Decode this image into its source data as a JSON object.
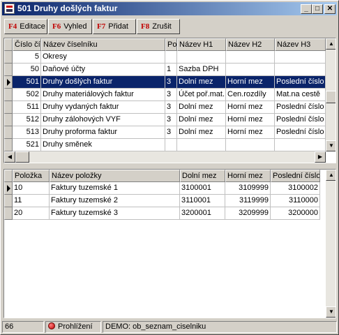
{
  "window": {
    "title": "501 Druhy došlých faktur"
  },
  "toolbar": [
    {
      "key": "F4",
      "label": "Editace"
    },
    {
      "key": "F6",
      "label": "Vyhled"
    },
    {
      "key": "F7",
      "label": "Přidat"
    },
    {
      "key": "F8",
      "label": "Zrušit"
    }
  ],
  "top_grid": {
    "columns": [
      "Číslo čí",
      "Název číselníku",
      "Po",
      "Název H1",
      "Název H2",
      "Název H3"
    ],
    "rows": [
      [
        "5",
        "Okresy",
        "",
        "",
        "",
        ""
      ],
      [
        "50",
        "Daňové účty",
        "1",
        "Sazba DPH",
        "",
        ""
      ],
      [
        "501",
        "Druhy došlých faktur",
        "3",
        "Dolní mez",
        "Horní mez",
        "Poslední číslo"
      ],
      [
        "502",
        "Druhy materiálových faktur",
        "3",
        "Účet poř.mat.",
        "Cen.rozdíly",
        "Mat.na cestě"
      ],
      [
        "511",
        "Druhy vydaných faktur",
        "3",
        "Dolní mez",
        "Horní mez",
        "Poslední číslo"
      ],
      [
        "512",
        "Druhy zálohových VYF",
        "3",
        "Dolní mez",
        "Horní mez",
        "Poslední číslo"
      ],
      [
        "513",
        "Druhy proforma faktur",
        "3",
        "Dolní mez",
        "Horní mez",
        "Poslední číslo"
      ],
      [
        "521",
        "Druhy směnek",
        "",
        "",
        "",
        ""
      ]
    ],
    "selected_row": 2
  },
  "bottom_grid": {
    "columns": [
      "Položka",
      "Název položky",
      "Dolní mez",
      "Horní mez",
      "Poslední číslo"
    ],
    "rows": [
      [
        "10",
        "Faktury tuzemské 1",
        "3100001",
        "3109999",
        "3100002"
      ],
      [
        "11",
        "Faktury tuzemské 2",
        "3110001",
        "3119999",
        "3110000"
      ],
      [
        "20",
        "Faktury tuzemské 3",
        "3200001",
        "3209999",
        "3200000"
      ]
    ],
    "current_row": 0
  },
  "status": {
    "count": "66",
    "mode": "Prohlížení",
    "info": "DEMO: ob_seznam_ciselniku"
  }
}
